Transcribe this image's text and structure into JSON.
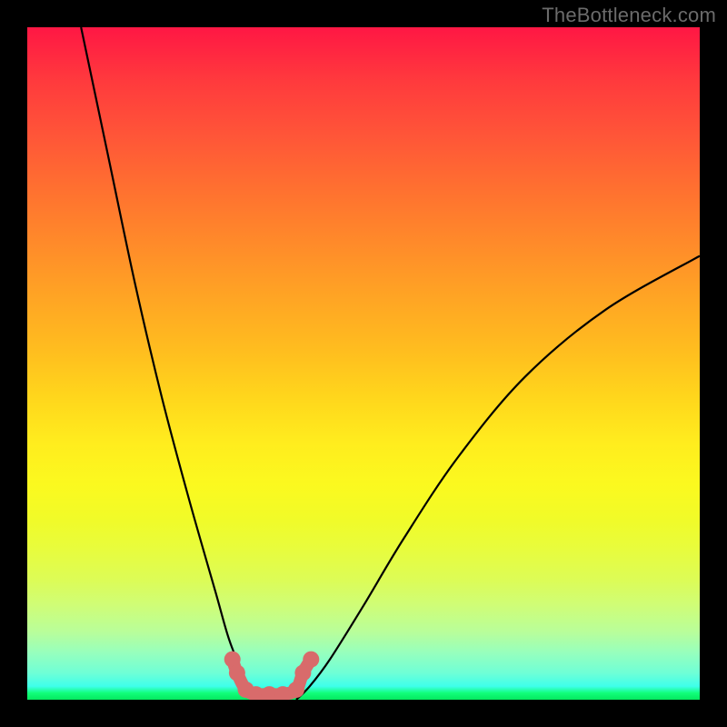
{
  "watermark": "TheBottleneck.com",
  "chart_data": {
    "type": "line",
    "title": "",
    "xlabel": "",
    "ylabel": "",
    "xlim": [
      0,
      100
    ],
    "ylim": [
      0,
      100
    ],
    "grid": false,
    "curve_left": {
      "x": [
        8,
        12,
        16,
        20,
        24,
        28,
        30,
        32,
        33,
        34,
        35
      ],
      "y": [
        100,
        81,
        62,
        45,
        30,
        16,
        9,
        4,
        2,
        1,
        0
      ]
    },
    "curve_right": {
      "x": [
        40,
        42,
        45,
        50,
        56,
        64,
        74,
        86,
        100
      ],
      "y": [
        0,
        2,
        6,
        14,
        24,
        36,
        48,
        58,
        66
      ]
    },
    "bottom_markers": {
      "x": [
        30.5,
        31.2,
        32.5,
        34.0,
        36.0,
        38.0,
        40.0,
        41.0,
        42.2
      ],
      "y": [
        6,
        4,
        1.5,
        0.8,
        0.8,
        0.8,
        1.5,
        4,
        6
      ]
    },
    "marker_color": "#d86b6b",
    "curve_color": "#000000",
    "gradient_stops": [
      {
        "pos": 0,
        "color": "#ff1744"
      },
      {
        "pos": 50,
        "color": "#ffd61c"
      },
      {
        "pos": 75,
        "color": "#f1fb28"
      },
      {
        "pos": 100,
        "color": "#05e85f"
      }
    ]
  }
}
